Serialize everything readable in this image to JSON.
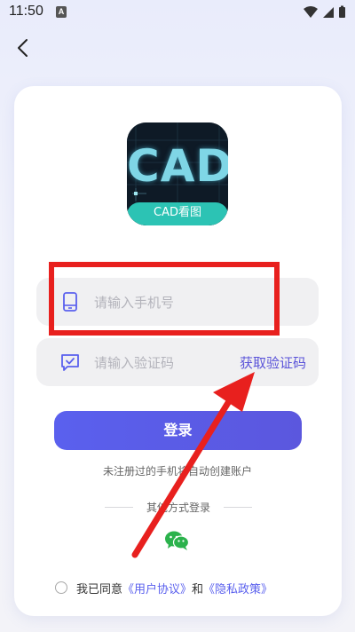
{
  "status_bar": {
    "time": "11:50",
    "notif_glyph": "A"
  },
  "header": {
    "back_icon": "chevron-left-icon"
  },
  "logo": {
    "main_text": "CAD",
    "band_text": "CAD看图"
  },
  "phone_field": {
    "placeholder": "请输入手机号",
    "icon": "phone-icon"
  },
  "code_field": {
    "placeholder": "请输入验证码",
    "icon": "message-check-icon",
    "get_code_label": "获取验证码"
  },
  "login": {
    "label": "登录"
  },
  "hint": "未注册过的手机将自动创建账户",
  "other_login": {
    "label": "其他方式登录",
    "wechat_icon": "wechat-icon"
  },
  "agreement": {
    "prefix": "我已同意",
    "user_agreement": "《用户协议》",
    "and": "和",
    "privacy_policy": "《隐私政策》"
  },
  "colors": {
    "accent": "#5a60ee",
    "annotation": "#e8201e",
    "logo_band": "#2cc3b4"
  }
}
